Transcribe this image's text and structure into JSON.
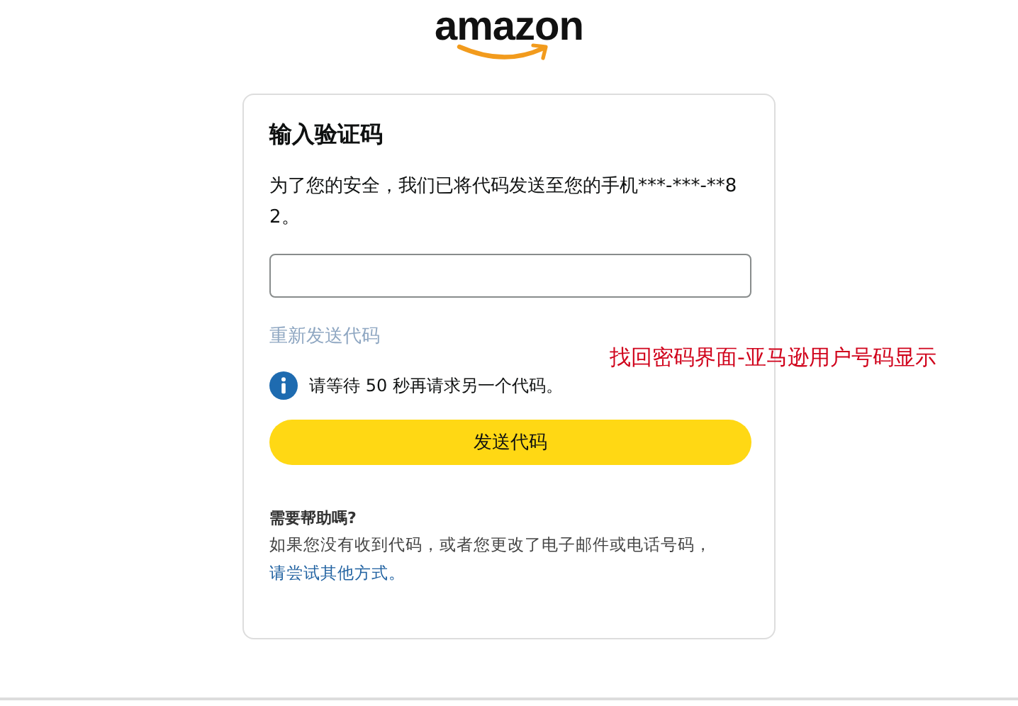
{
  "logo": {
    "text": "amazon"
  },
  "card": {
    "title": "输入验证码",
    "message": "为了您的安全，我们已将代码发送至您的手机***-***-**82。",
    "resend_link": {
      "label": "重新发送代码",
      "disabled": true
    },
    "notice": "请等待 50 秒再请求另一个代码。",
    "submit_button": "发送代码",
    "help": {
      "title": "需要帮助嗎?",
      "text": "如果您没有收到代码，或者您更改了电子邮件或电话号码，",
      "link": "请尝试其他方式。"
    }
  },
  "annotation": "找回密码界面-亚马逊用户号码显示"
}
